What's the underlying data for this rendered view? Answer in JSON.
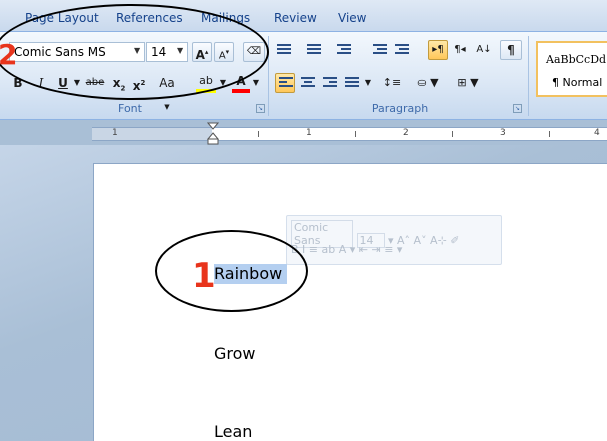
{
  "tabs": [
    "Page Layout",
    "References",
    "Mailings",
    "Review",
    "View"
  ],
  "font_group": {
    "font_name": "Comic Sans MS",
    "font_size": "14",
    "grow_label": "A",
    "shrink_label": "A",
    "bold": "B",
    "italic": "I",
    "underline": "U",
    "strikethrough": "abe",
    "subscript": "x",
    "superscript": "x",
    "change_case": "Aa",
    "highlight": "ab",
    "font_color": "A",
    "label": "Font"
  },
  "paragraph_group": {
    "label": "Paragraph",
    "pilcrow": "¶"
  },
  "styles_group": {
    "sample": "AaBbCcDd",
    "style_name": "¶ Normal"
  },
  "ruler": {
    "numbers": [
      "1",
      "1",
      "2",
      "3",
      "4"
    ]
  },
  "mini_toolbar": {
    "font_name": "Comic Sans",
    "font_size": "14",
    "row2": "B  I  ≡  ab  A"
  },
  "document": {
    "lines": [
      "Rainbow",
      "Grow",
      "Lean"
    ]
  },
  "annotations": {
    "step1": "1",
    "step2": "2"
  },
  "colors": {
    "annotation_red": "#e8341c",
    "selection": "#b4cff0",
    "ribbon_text": "#15428b"
  }
}
